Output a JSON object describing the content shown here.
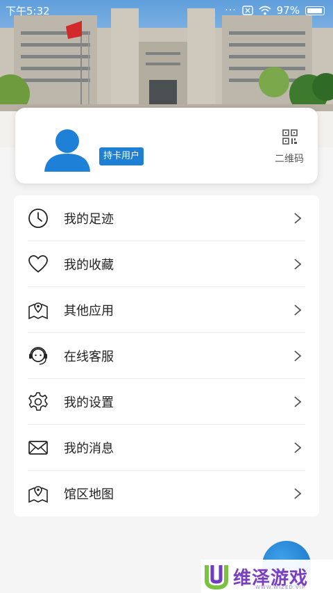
{
  "status_bar": {
    "time": "下午5:32",
    "battery": "97%",
    "battery_level": 0.97
  },
  "profile": {
    "badge": "持卡用户",
    "qr_label": "二维码"
  },
  "menu": {
    "items": [
      {
        "label": "我的足迹",
        "icon": "clock-icon"
      },
      {
        "label": "我的收藏",
        "icon": "heart-icon"
      },
      {
        "label": "其他应用",
        "icon": "map-pin-icon"
      },
      {
        "label": "在线客服",
        "icon": "headset-icon"
      },
      {
        "label": "我的设置",
        "icon": "gear-icon"
      },
      {
        "label": "我的消息",
        "icon": "mail-icon"
      },
      {
        "label": "馆区地图",
        "icon": "map-pin-icon"
      }
    ]
  },
  "watermark": {
    "text": "维泽游戏",
    "sub": "WWW.WIZED.VIP"
  },
  "colors": {
    "accent": "#1f7fd3",
    "watermark": "#7a3fc0"
  }
}
